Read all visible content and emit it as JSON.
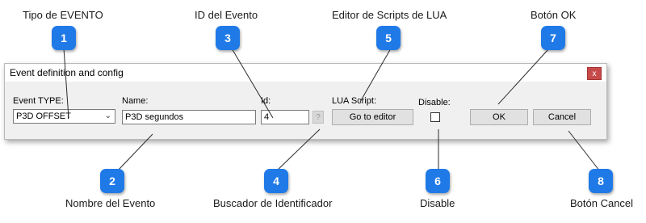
{
  "callouts": [
    {
      "number": "1",
      "label": "Tipo de EVENTO"
    },
    {
      "number": "2",
      "label": "Nombre del Evento"
    },
    {
      "number": "3",
      "label": "ID del Evento"
    },
    {
      "number": "4",
      "label": "Buscador de Identificador"
    },
    {
      "number": "5",
      "label": "Editor de Scripts de LUA"
    },
    {
      "number": "6",
      "label": "Disable"
    },
    {
      "number": "7",
      "label": "Botón OK"
    },
    {
      "number": "8",
      "label": "Botón Cancel"
    }
  ],
  "dialog": {
    "title": "Event definition and config",
    "close_glyph": "x",
    "event_type_label": "Event TYPE:",
    "event_type_value": "P3D OFFSET",
    "name_label": "Name:",
    "name_value": "P3D segundos",
    "id_label": "Id:",
    "id_value": "4",
    "id_lookup_glyph": "?",
    "lua_label": "LUA Script:",
    "goto_editor": "Go to editor",
    "disable_label": "Disable:",
    "disable_checked": false,
    "ok_label": "OK",
    "cancel_label": "Cancel"
  },
  "colors": {
    "badge": "#1f7ae8",
    "close": "#c74a4a"
  }
}
